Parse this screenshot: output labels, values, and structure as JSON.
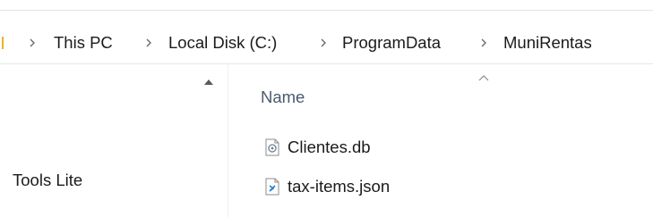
{
  "breadcrumb": {
    "items": [
      {
        "label": "This PC"
      },
      {
        "label": "Local Disk (C:)"
      },
      {
        "label": "ProgramData"
      },
      {
        "label": "MuniRentas"
      }
    ]
  },
  "navigation": {
    "visible_item": "Tools Lite"
  },
  "file_list": {
    "column_header": "Name",
    "files": [
      {
        "name": "Clientes.db",
        "icon": "database-file-icon"
      },
      {
        "name": "tax-items.json",
        "icon": "json-file-icon"
      }
    ]
  }
}
